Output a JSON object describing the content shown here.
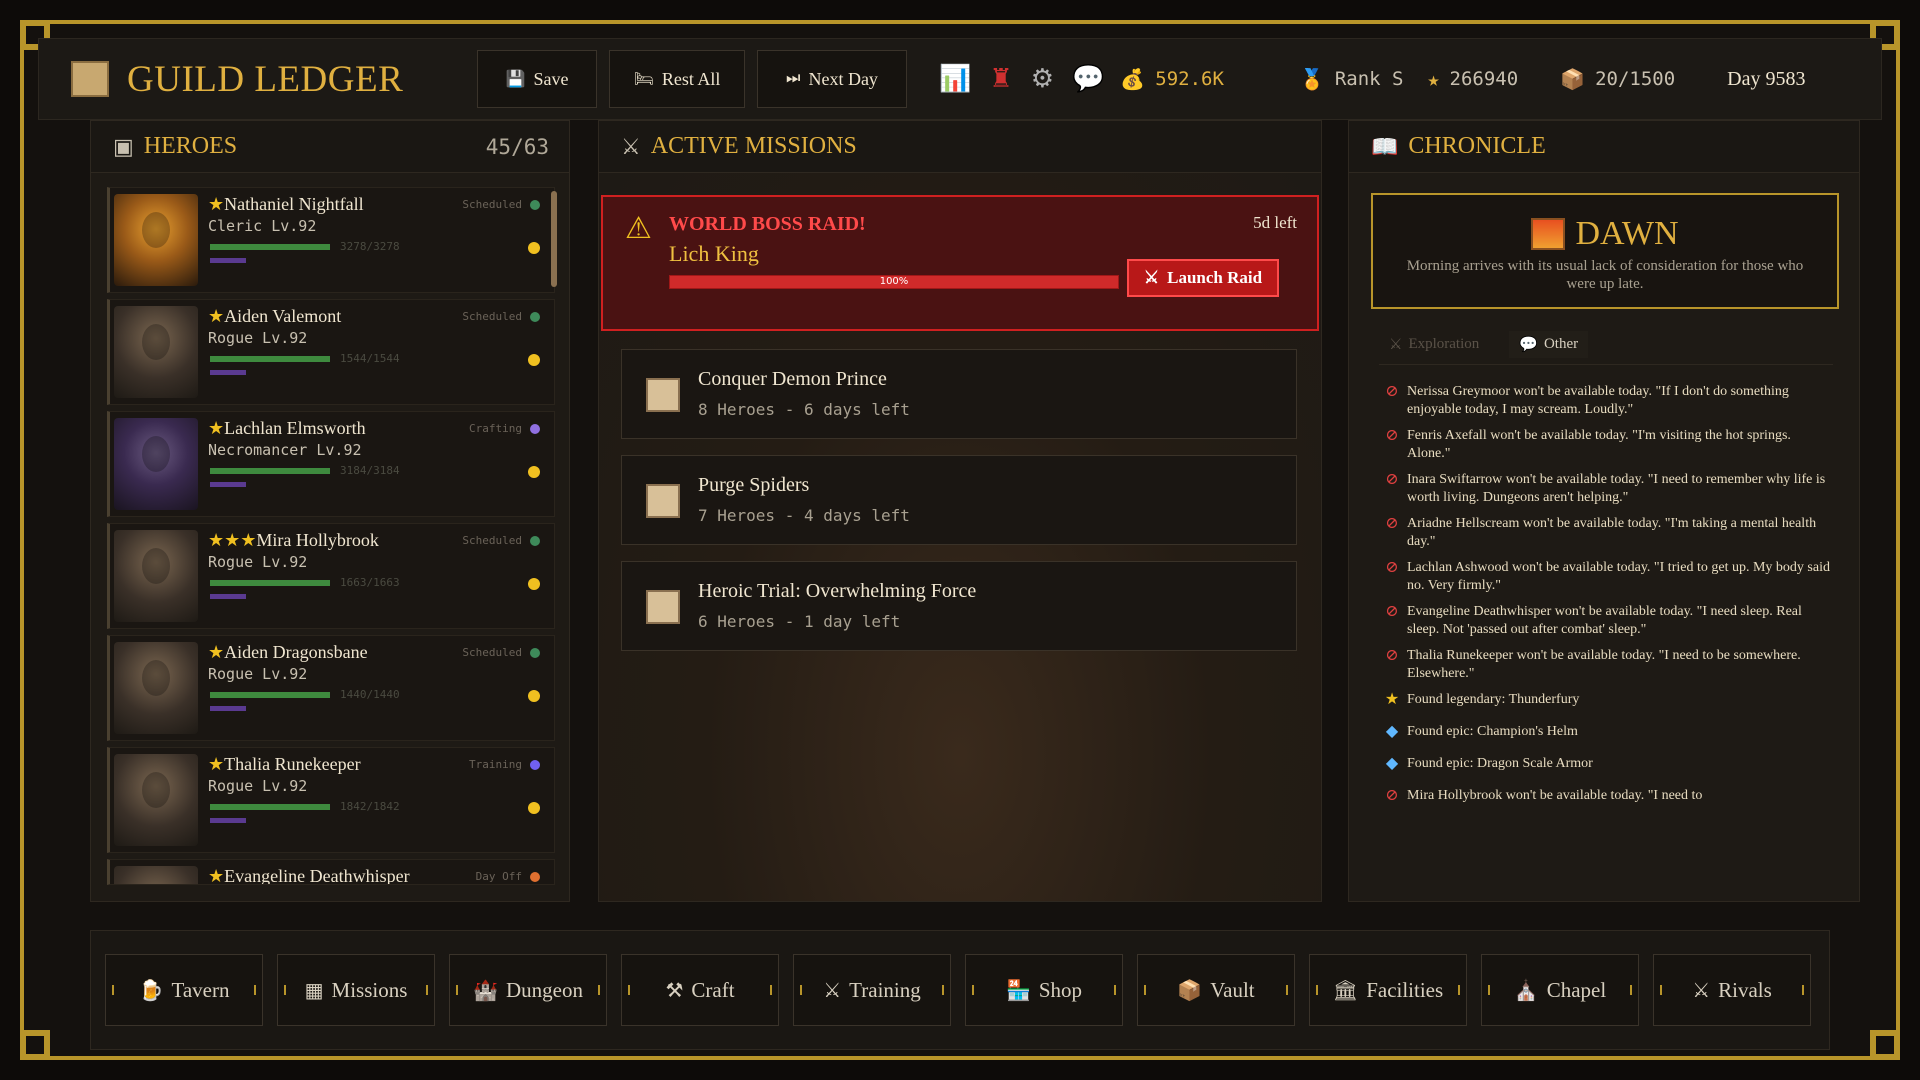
{
  "header": {
    "title": "GUILD LEDGER",
    "buttons": [
      {
        "label": "Save",
        "icon": "💾"
      },
      {
        "label": "Rest All",
        "icon": "🛏"
      },
      {
        "label": "Next Day",
        "icon": "⏭"
      }
    ],
    "gold": "592.6K",
    "rank": "Rank S",
    "score": "266940",
    "storage": "20/1500",
    "day": "Day 9583"
  },
  "heroes": {
    "title": "HEROES",
    "count": "45/63",
    "list": [
      {
        "stars": "★",
        "name": "Nathaniel Nightfall",
        "class": "Cleric Lv.92",
        "status": "Scheduled",
        "status_color": "#3e8a5a",
        "hp": "3278/3278",
        "hp_fraction": 1.0
      },
      {
        "stars": "★",
        "name": "Aiden Valemont",
        "class": "Rogue Lv.92",
        "status": "Scheduled",
        "status_color": "#3e8a5a",
        "hp": "1544/1544",
        "hp_fraction": 1.0
      },
      {
        "stars": "★",
        "name": "Lachlan Elmsworth",
        "class": "Necromancer Lv.92",
        "status": "Crafting",
        "status_color": "#9070e0",
        "hp": "3184/3184",
        "hp_fraction": 1.0
      },
      {
        "stars": "★★★",
        "name": "Mira Hollybrook",
        "class": "Rogue Lv.92",
        "status": "Scheduled",
        "status_color": "#3e8a5a",
        "hp": "1663/1663",
        "hp_fraction": 1.0
      },
      {
        "stars": "★",
        "name": "Aiden Dragonsbane",
        "class": "Rogue Lv.92",
        "status": "Scheduled",
        "status_color": "#3e8a5a",
        "hp": "1440/1440",
        "hp_fraction": 1.0
      },
      {
        "stars": "★",
        "name": "Thalia Runekeeper",
        "class": "Rogue Lv.92",
        "status": "Training",
        "status_color": "#7060f0",
        "hp": "1842/1842",
        "hp_fraction": 1.0
      },
      {
        "stars": "★",
        "name": "Evangeline Deathwhisper",
        "class": "",
        "status": "Day Off",
        "status_color": "#e07030",
        "hp": "",
        "hp_fraction": 1.0
      }
    ]
  },
  "missions": {
    "title": "ACTIVE MISSIONS",
    "boss": {
      "title": "WORLD BOSS RAID!",
      "name": "Lich King",
      "time_left": "5d left",
      "progress_label": "100%",
      "progress": 1.0,
      "launch_label": "Launch Raid"
    },
    "list": [
      {
        "name": "Conquer Demon Prince",
        "desc": "8 Heroes - 6 days left"
      },
      {
        "name": "Purge Spiders",
        "desc": "7 Heroes - 4 days left"
      },
      {
        "name": "Heroic Trial: Overwhelming Force",
        "desc": "6 Heroes - 1 day left"
      }
    ]
  },
  "chronicle": {
    "title": "CHRONICLE",
    "dawn_title": "DAWN",
    "dawn_text": "Morning arrives with its usual lack of consideration for those who were up late.",
    "tabs": [
      {
        "label": "Exploration",
        "active": false
      },
      {
        "label": "Other",
        "active": true
      }
    ],
    "entries": [
      {
        "type": "unavailable",
        "text": "Nerissa Greymoor won't be available today. \"If I don't do something enjoyable today, I may scream. Loudly.\""
      },
      {
        "type": "unavailable",
        "text": "Fenris Axefall won't be available today. \"I'm visiting the hot springs. Alone.\""
      },
      {
        "type": "unavailable",
        "text": "Inara Swiftarrow won't be available today. \"I need to remember why life is worth living. Dungeons aren't helping.\""
      },
      {
        "type": "unavailable",
        "text": "Ariadne Hellscream won't be available today. \"I'm taking a mental health day.\""
      },
      {
        "type": "unavailable",
        "text": "Lachlan Ashwood won't be available today. \"I tried to get up. My body said no. Very firmly.\""
      },
      {
        "type": "unavailable",
        "text": "Evangeline Deathwhisper won't be available today. \"I need sleep. Real sleep. Not 'passed out after combat' sleep.\""
      },
      {
        "type": "unavailable",
        "text": "Thalia Runekeeper won't be available today. \"I need to be somewhere. Elsewhere.\""
      },
      {
        "type": "legendary",
        "text": "Found legendary: Thunderfury"
      },
      {
        "type": "epic",
        "text": "Found epic: Champion's Helm"
      },
      {
        "type": "epic",
        "text": "Found epic: Dragon Scale Armor"
      },
      {
        "type": "unavailable",
        "text": "Mira Hollybrook won't be available today. \"I need to"
      }
    ]
  },
  "nav": [
    {
      "label": "Tavern",
      "icon": "🍺",
      "icon_name": "tavern-icon"
    },
    {
      "label": "Missions",
      "icon": "▦",
      "icon_name": "missions-icon"
    },
    {
      "label": "Dungeon",
      "icon": "🏰",
      "icon_name": "dungeon-icon"
    },
    {
      "label": "Craft",
      "icon": "⚒",
      "icon_name": "craft-icon"
    },
    {
      "label": "Training",
      "icon": "⚔",
      "icon_name": "training-icon"
    },
    {
      "label": "Shop",
      "icon": "🏪",
      "icon_name": "shop-icon"
    },
    {
      "label": "Vault",
      "icon": "📦",
      "icon_name": "vault-icon"
    },
    {
      "label": "Facilities",
      "icon": "🏛",
      "icon_name": "facilities-icon"
    },
    {
      "label": "Chapel",
      "icon": "⛪",
      "icon_name": "chapel-icon"
    },
    {
      "label": "Rivals",
      "icon": "⚔",
      "icon_name": "rivals-icon"
    }
  ]
}
